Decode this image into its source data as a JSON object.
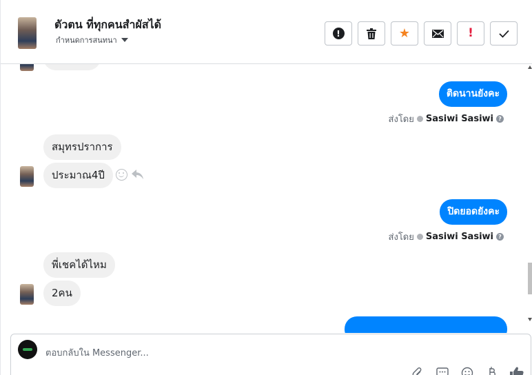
{
  "header": {
    "title": "ตัวตน ที่ทุกคนสำผัสได้",
    "subtitle": "กำหนดการสนทนา",
    "toolbar": [
      {
        "name": "alert-button",
        "icon": "exclamation-circle-icon"
      },
      {
        "name": "delete-button",
        "icon": "trash-icon"
      },
      {
        "name": "star-button",
        "icon": "star-icon",
        "color": "#f5831f"
      },
      {
        "name": "mail-button",
        "icon": "envelope-icon"
      },
      {
        "name": "spam-button",
        "icon": "exclamation-icon",
        "color": "#e41e3f"
      },
      {
        "name": "done-button",
        "icon": "check-icon"
      }
    ]
  },
  "messages": {
    "out_1": "ติดนานยังคะ",
    "sent_by_label": "ส่งโดย",
    "sent_by_name": "Sasiwi Sasiwi",
    "in_1": "สมุทรปราการ",
    "in_2": "ประมาณ4ปี",
    "out_2": "ปิดยอดยังคะ",
    "in_3": "พี่เชคได้ไหม",
    "in_4": "2คน"
  },
  "composer": {
    "placeholder": "ตอบกลับใน Messenger..."
  },
  "colors": {
    "accent": "#0084ff",
    "incoming_bubble": "#f0f0f0",
    "star": "#f5831f",
    "spam": "#e41e3f"
  }
}
